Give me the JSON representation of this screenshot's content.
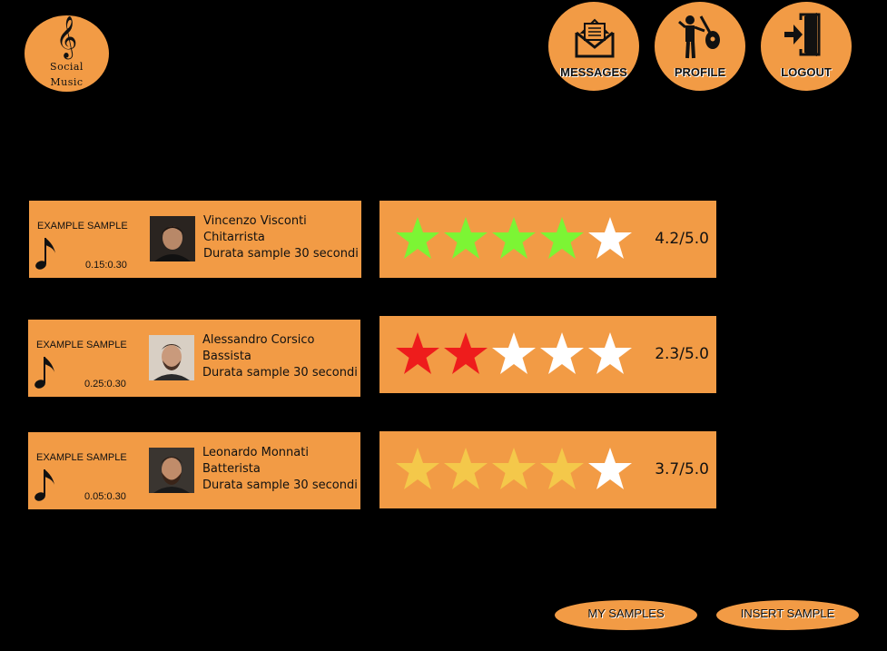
{
  "logo": {
    "symbol": "𝄞",
    "line1": "Social",
    "line2": "Music"
  },
  "nav": {
    "messages": "MESSAGES",
    "profile": "PROFILE",
    "logout": "LOGOUT"
  },
  "samples": [
    {
      "title": "EXAMPLE SAMPLE",
      "time": "0.15:0.30",
      "name": "Vincenzo Visconti",
      "role": "Chitarrista",
      "duration": "Durata sample 30 secondi",
      "score": "4.2/5.0",
      "rating": 4.2,
      "star_color": "#7cf534"
    },
    {
      "title": "EXAMPLE SAMPLE",
      "time": "0.25:0.30",
      "name": "Alessandro Corsico",
      "role": "Bassista",
      "duration": "Durata sample 30 secondi",
      "score": "2.3/5.0",
      "rating": 2.3,
      "star_color": "#ee1c1c"
    },
    {
      "title": "EXAMPLE SAMPLE",
      "time": "0.05:0.30",
      "name": "Leonardo Monnati",
      "role": "Batterista",
      "duration": "Durata sample 30 secondi",
      "score": "3.7/5.0",
      "rating": 3.7,
      "star_color": "#f4c84a"
    }
  ],
  "buttons": {
    "my_samples": "MY SAMPLES",
    "insert_sample": "INSERT SAMPLE"
  },
  "colors": {
    "accent": "#f29b45",
    "background": "#000000",
    "empty_star": "#ffffff"
  }
}
